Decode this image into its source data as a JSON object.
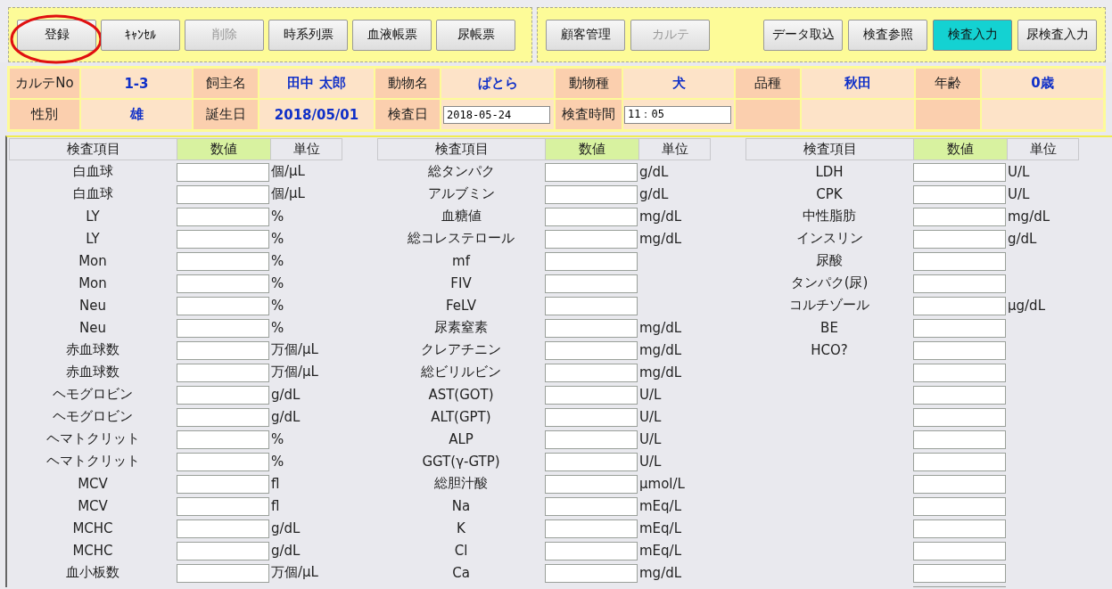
{
  "toolbar": {
    "left": [
      {
        "label": "登録",
        "disabled": false,
        "selected": false,
        "circled": true
      },
      {
        "label": "ｷｬﾝｾﾙ",
        "disabled": false,
        "selected": false,
        "circled": false
      },
      {
        "label": "削除",
        "disabled": true,
        "selected": false,
        "circled": false
      },
      {
        "label": "時系列票",
        "disabled": false,
        "selected": false,
        "circled": false
      },
      {
        "label": "血液帳票",
        "disabled": false,
        "selected": false,
        "circled": false
      },
      {
        "label": "尿帳票",
        "disabled": false,
        "selected": false,
        "circled": false
      }
    ],
    "right_first": [
      {
        "label": "顧客管理",
        "disabled": false,
        "selected": false,
        "circled": false
      },
      {
        "label": "カルテ",
        "disabled": true,
        "selected": false,
        "circled": false
      }
    ],
    "right_second": [
      {
        "label": "データ取込",
        "disabled": false,
        "selected": false,
        "circled": false
      },
      {
        "label": "検査参照",
        "disabled": false,
        "selected": false,
        "circled": false
      },
      {
        "label": "検査入力",
        "disabled": false,
        "selected": true,
        "circled": false
      },
      {
        "label": "尿検査入力",
        "disabled": false,
        "selected": false,
        "circled": false
      }
    ]
  },
  "info": {
    "rows": [
      [
        {
          "kind": "label",
          "text": "カルテNo"
        },
        {
          "kind": "value",
          "text": "1-3"
        },
        {
          "kind": "label",
          "text": "飼主名"
        },
        {
          "kind": "value",
          "text": "田中 太郎"
        },
        {
          "kind": "label",
          "text": "動物名"
        },
        {
          "kind": "value",
          "text": "ぱとら"
        },
        {
          "kind": "label",
          "text": "動物種"
        },
        {
          "kind": "value",
          "text": "犬"
        },
        {
          "kind": "label",
          "text": "品種"
        },
        {
          "kind": "value",
          "text": "秋田"
        },
        {
          "kind": "label",
          "text": "年齢"
        },
        {
          "kind": "value",
          "text": "0歳"
        }
      ],
      [
        {
          "kind": "label",
          "text": "性別"
        },
        {
          "kind": "value",
          "text": "雄"
        },
        {
          "kind": "label",
          "text": "誕生日"
        },
        {
          "kind": "value",
          "text": "2018/05/01"
        },
        {
          "kind": "label",
          "text": "検査日"
        },
        {
          "kind": "input",
          "text": "2018-05-24"
        },
        {
          "kind": "label",
          "text": "検査時間"
        },
        {
          "kind": "input",
          "text": "11：05"
        },
        {
          "kind": "blank_label"
        },
        {
          "kind": "blank_value"
        },
        {
          "kind": "blank_label"
        },
        {
          "kind": "blank_value"
        }
      ]
    ]
  },
  "tests": {
    "groups": [
      {
        "columns": [
          "検査項目",
          "数値",
          "単位"
        ],
        "rows": [
          {
            "item": "白血球",
            "unit": "個/μL"
          },
          {
            "item": "白血球",
            "unit": "個/μL"
          },
          {
            "item": "LY",
            "unit": "%"
          },
          {
            "item": "LY",
            "unit": "%"
          },
          {
            "item": "Mon",
            "unit": "%"
          },
          {
            "item": "Mon",
            "unit": "%"
          },
          {
            "item": "Neu",
            "unit": "%"
          },
          {
            "item": "Neu",
            "unit": "%"
          },
          {
            "item": "赤血球数",
            "unit": "万個/μL"
          },
          {
            "item": "赤血球数",
            "unit": "万個/μL"
          },
          {
            "item": "ヘモグロビン",
            "unit": "g/dL"
          },
          {
            "item": "ヘモグロビン",
            "unit": "g/dL"
          },
          {
            "item": "ヘマトクリット",
            "unit": "%"
          },
          {
            "item": "ヘマトクリット",
            "unit": "%"
          },
          {
            "item": "MCV",
            "unit": "fl"
          },
          {
            "item": "MCV",
            "unit": "fl"
          },
          {
            "item": "MCHC",
            "unit": "g/dL"
          },
          {
            "item": "MCHC",
            "unit": "g/dL"
          },
          {
            "item": "血小板数",
            "unit": "万個/μL"
          }
        ]
      },
      {
        "columns": [
          "検査項目",
          "数値",
          "単位"
        ],
        "rows": [
          {
            "item": "総タンパク",
            "unit": "g/dL"
          },
          {
            "item": "アルブミン",
            "unit": "g/dL"
          },
          {
            "item": "血糖値",
            "unit": "mg/dL"
          },
          {
            "item": "総コレステロール",
            "unit": "mg/dL"
          },
          {
            "item": "mf"
          },
          {
            "item": "FIV"
          },
          {
            "item": "FeLV"
          },
          {
            "item": "尿素窒素",
            "unit": "mg/dL"
          },
          {
            "item": "クレアチニン",
            "unit": "mg/dL"
          },
          {
            "item": "総ビリルビン",
            "unit": "mg/dL"
          },
          {
            "item": "AST(GOT)",
            "unit": "U/L"
          },
          {
            "item": "ALT(GPT)",
            "unit": "U/L"
          },
          {
            "item": "ALP",
            "unit": "U/L"
          },
          {
            "item": "GGT(γ-GTP)",
            "unit": "U/L"
          },
          {
            "item": "総胆汁酸",
            "unit": "μmol/L"
          },
          {
            "item": "Na",
            "unit": "mEq/L"
          },
          {
            "item": "K",
            "unit": "mEq/L"
          },
          {
            "item": "Cl",
            "unit": "mEq/L"
          },
          {
            "item": "Ca",
            "unit": "mg/dL"
          }
        ]
      },
      {
        "columns": [
          "検査項目",
          "数値",
          "単位"
        ],
        "rows": [
          {
            "item": "LDH",
            "unit": "U/L"
          },
          {
            "item": "CPK",
            "unit": "U/L"
          },
          {
            "item": "中性脂肪",
            "unit": "mg/dL"
          },
          {
            "item": "インスリン",
            "unit": "g/dL"
          },
          {
            "item": "尿酸"
          },
          {
            "item": "タンパク(尿)"
          },
          {
            "item": "コルチゾール",
            "unit": "μg/dL"
          },
          {
            "item": "BE"
          },
          {
            "item": "HCO?"
          },
          {},
          {},
          {},
          {},
          {},
          {},
          {},
          {},
          {},
          {},
          {}
        ]
      }
    ]
  }
}
